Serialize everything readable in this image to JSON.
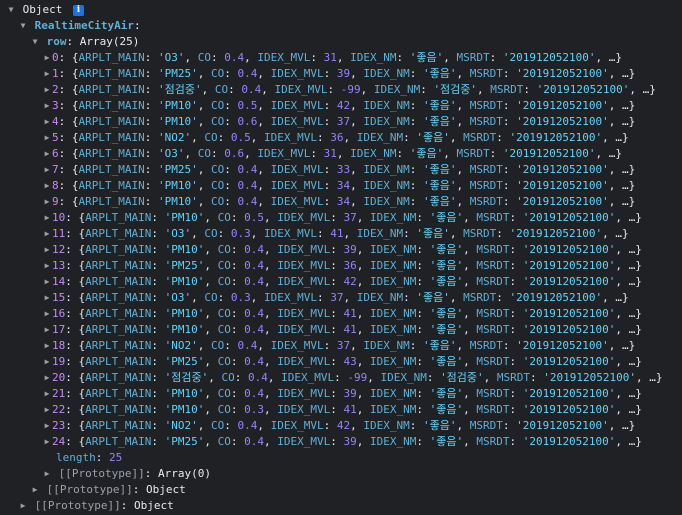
{
  "root": {
    "label": "Object",
    "info_icon": "info-icon",
    "child_key": "RealtimeCityAir",
    "row_key": "row",
    "row_type": "Array(25)",
    "rows": [
      {
        "index": "0",
        "main": "'O3'",
        "co": "0.4",
        "mvl": "31",
        "nm": "'좋음'",
        "msrdt": "'201912052100'"
      },
      {
        "index": "1",
        "main": "'PM25'",
        "co": "0.4",
        "mvl": "39",
        "nm": "'좋음'",
        "msrdt": "'201912052100'"
      },
      {
        "index": "2",
        "main": "'점검중'",
        "co": "0.4",
        "mvl": "-99",
        "nm": "'점검중'",
        "msrdt": "'201912052100'"
      },
      {
        "index": "3",
        "main": "'PM10'",
        "co": "0.5",
        "mvl": "42",
        "nm": "'좋음'",
        "msrdt": "'201912052100'"
      },
      {
        "index": "4",
        "main": "'PM10'",
        "co": "0.6",
        "mvl": "37",
        "nm": "'좋음'",
        "msrdt": "'201912052100'"
      },
      {
        "index": "5",
        "main": "'NO2'",
        "co": "0.5",
        "mvl": "36",
        "nm": "'좋음'",
        "msrdt": "'201912052100'"
      },
      {
        "index": "6",
        "main": "'O3'",
        "co": "0.6",
        "mvl": "31",
        "nm": "'좋음'",
        "msrdt": "'201912052100'"
      },
      {
        "index": "7",
        "main": "'PM25'",
        "co": "0.4",
        "mvl": "33",
        "nm": "'좋음'",
        "msrdt": "'201912052100'"
      },
      {
        "index": "8",
        "main": "'PM10'",
        "co": "0.4",
        "mvl": "34",
        "nm": "'좋음'",
        "msrdt": "'201912052100'"
      },
      {
        "index": "9",
        "main": "'PM10'",
        "co": "0.4",
        "mvl": "34",
        "nm": "'좋음'",
        "msrdt": "'201912052100'"
      },
      {
        "index": "10",
        "main": "'PM10'",
        "co": "0.5",
        "mvl": "37",
        "nm": "'좋음'",
        "msrdt": "'201912052100'"
      },
      {
        "index": "11",
        "main": "'O3'",
        "co": "0.3",
        "mvl": "41",
        "nm": "'좋음'",
        "msrdt": "'201912052100'"
      },
      {
        "index": "12",
        "main": "'PM10'",
        "co": "0.4",
        "mvl": "39",
        "nm": "'좋음'",
        "msrdt": "'201912052100'"
      },
      {
        "index": "13",
        "main": "'PM25'",
        "co": "0.4",
        "mvl": "36",
        "nm": "'좋음'",
        "msrdt": "'201912052100'"
      },
      {
        "index": "14",
        "main": "'PM10'",
        "co": "0.4",
        "mvl": "42",
        "nm": "'좋음'",
        "msrdt": "'201912052100'"
      },
      {
        "index": "15",
        "main": "'O3'",
        "co": "0.3",
        "mvl": "37",
        "nm": "'좋음'",
        "msrdt": "'201912052100'"
      },
      {
        "index": "16",
        "main": "'PM10'",
        "co": "0.4",
        "mvl": "41",
        "nm": "'좋음'",
        "msrdt": "'201912052100'"
      },
      {
        "index": "17",
        "main": "'PM10'",
        "co": "0.4",
        "mvl": "41",
        "nm": "'좋음'",
        "msrdt": "'201912052100'"
      },
      {
        "index": "18",
        "main": "'NO2'",
        "co": "0.4",
        "mvl": "37",
        "nm": "'좋음'",
        "msrdt": "'201912052100'"
      },
      {
        "index": "19",
        "main": "'PM25'",
        "co": "0.4",
        "mvl": "43",
        "nm": "'좋음'",
        "msrdt": "'201912052100'"
      },
      {
        "index": "20",
        "main": "'점검중'",
        "co": "0.4",
        "mvl": "-99",
        "nm": "'점검중'",
        "msrdt": "'201912052100'"
      },
      {
        "index": "21",
        "main": "'PM10'",
        "co": "0.4",
        "mvl": "39",
        "nm": "'좋음'",
        "msrdt": "'201912052100'"
      },
      {
        "index": "22",
        "main": "'PM10'",
        "co": "0.3",
        "mvl": "41",
        "nm": "'좋음'",
        "msrdt": "'201912052100'"
      },
      {
        "index": "23",
        "main": "'NO2'",
        "co": "0.4",
        "mvl": "42",
        "nm": "'좋음'",
        "msrdt": "'201912052100'"
      },
      {
        "index": "24",
        "main": "'PM25'",
        "co": "0.4",
        "mvl": "39",
        "nm": "'좋음'",
        "msrdt": "'201912052100'"
      }
    ],
    "field_labels": {
      "main": "ARPLT_MAIN",
      "co": "CO",
      "mvl": "IDEX_MVL",
      "nm": "IDEX_NM",
      "msrdt": "MSRDT"
    },
    "ellipsis": "…}",
    "length_key": "length",
    "length_value": "25",
    "proto_key": "[[Prototype]]",
    "proto_array": "Array(0)",
    "proto_object": "Object"
  }
}
